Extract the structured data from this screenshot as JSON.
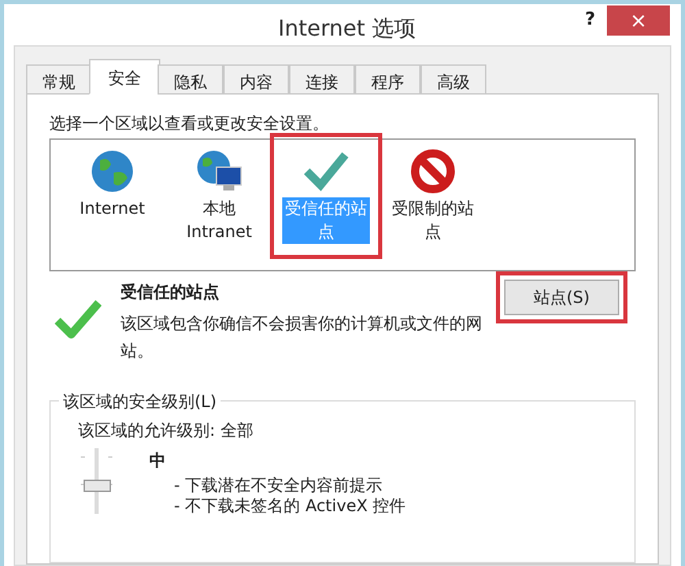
{
  "window": {
    "title": "Internet 选项",
    "help": "?",
    "close": "×"
  },
  "tabs": [
    {
      "label": "常规",
      "selected": false
    },
    {
      "label": "安全",
      "selected": true
    },
    {
      "label": "隐私",
      "selected": false
    },
    {
      "label": "内容",
      "selected": false
    },
    {
      "label": "连接",
      "selected": false
    },
    {
      "label": "程序",
      "selected": false
    },
    {
      "label": "高级",
      "selected": false
    }
  ],
  "prompt": "选择一个区域以查看或更改安全设置。",
  "zones": [
    {
      "label": "Internet",
      "kind": "globe",
      "selected": false,
      "highlighted": false
    },
    {
      "label": "本地 Intranet",
      "kind": "intranet",
      "selected": false,
      "highlighted": false
    },
    {
      "label": "受信任的站点",
      "kind": "trusted",
      "selected": true,
      "highlighted": true
    },
    {
      "label": "受限制的站点",
      "kind": "restricted",
      "selected": false,
      "highlighted": false
    }
  ],
  "zone_info": {
    "title": "受信任的站点",
    "description": "该区域包含你确信不会损害你的计算机或文件的网站。"
  },
  "sites_button": {
    "label": "站点(S)",
    "highlighted": true
  },
  "security_level": {
    "legend": "该区域的安全级别(L)",
    "allowed": "该区域的允许级别: 全部",
    "level_name": "中",
    "level": 0.4,
    "bullets": [
      "- 下载潜在不安全内容前提示",
      "- 不下载未签名的 ActiveX 控件"
    ]
  }
}
